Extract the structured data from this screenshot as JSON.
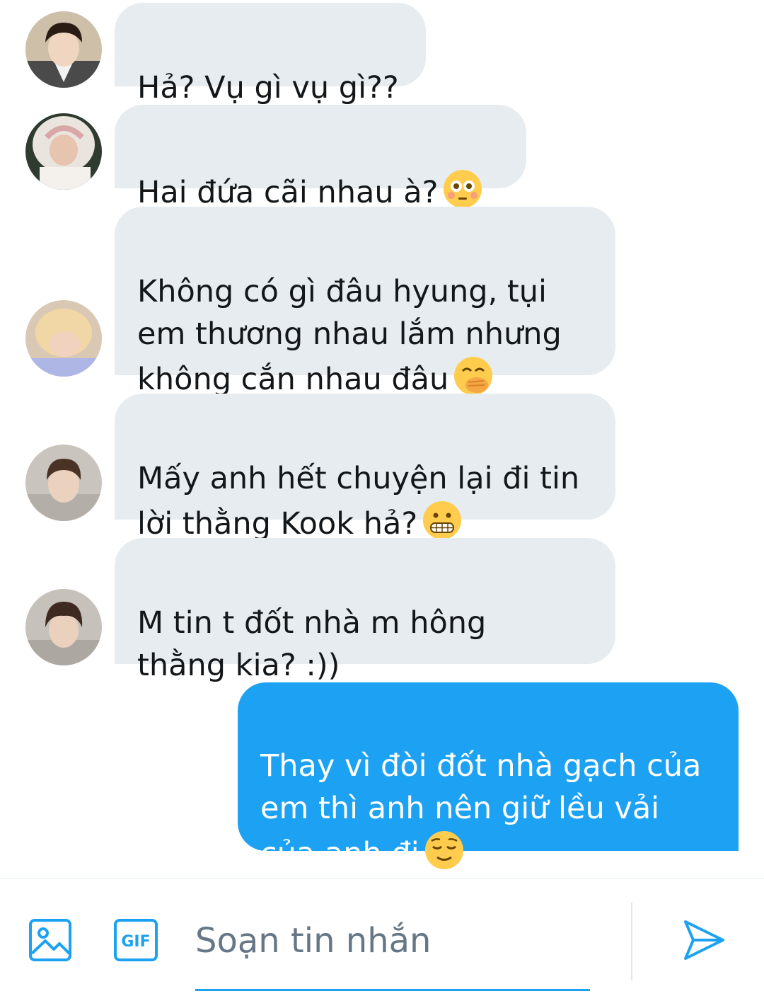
{
  "messages": [
    {
      "direction": "incoming",
      "text": "Hả? Vụ gì vụ gì??",
      "avatar": "avatar-1",
      "emoji": ""
    },
    {
      "direction": "incoming",
      "text": "Hai đứa cãi nhau à?",
      "avatar": "avatar-2",
      "emoji": "flushed-face-emoji"
    },
    {
      "direction": "incoming",
      "text": "Không có gì đâu hyung, tụi\nem thương nhau lắm nhưng\nkhông cắn nhau đâu",
      "avatar": "avatar-3",
      "emoji": "hand-over-mouth-emoji"
    },
    {
      "direction": "incoming",
      "text": "Mấy anh hết chuyện lại đi tin\nlời thằng Kook hả?",
      "avatar": "avatar-4",
      "emoji": "grimacing-face-emoji"
    },
    {
      "direction": "incoming",
      "text": "M tin t đốt nhà m hông\nthằng kia? :))",
      "avatar": "avatar-5",
      "emoji": ""
    },
    {
      "direction": "outgoing",
      "text": "Thay vì đòi đốt nhà gạch của\nem thì anh nên giữ lều vải\ncủa anh đi",
      "avatar": "",
      "emoji": "relieved-face-emoji"
    }
  ],
  "composer": {
    "placeholder": "Soạn tin nhắn",
    "gif_label": "GIF",
    "icons": [
      "image-icon",
      "gif-icon",
      "send-icon"
    ]
  },
  "colors": {
    "accent": "#1da1f2",
    "incoming_bubble": "#e6ecf0",
    "text": "#14171a",
    "placeholder": "#657786"
  }
}
